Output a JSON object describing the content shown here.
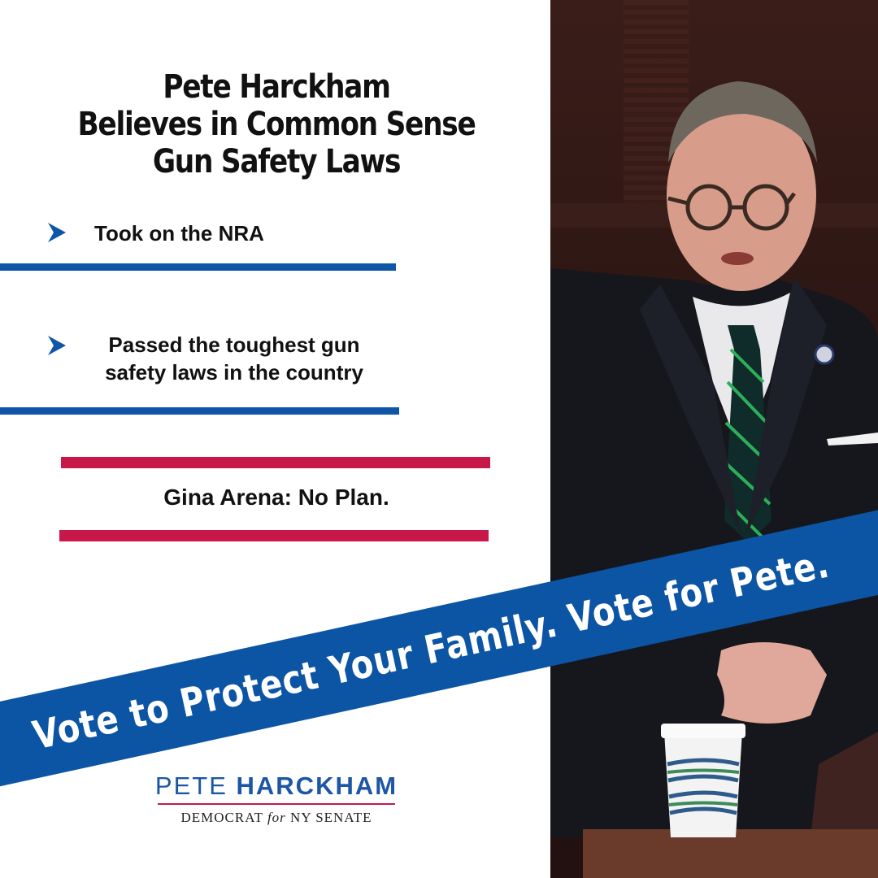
{
  "title": {
    "line1": "Pete Harckham",
    "line2": "Believes in Common Sense",
    "line3": "Gun Safety Laws"
  },
  "bullets": [
    {
      "text_line1": "Took on the NRA",
      "text_line2": "",
      "icon": "chevron-right-icon"
    },
    {
      "text_line1": "Passed the toughest gun",
      "text_line2": "safety laws in the country",
      "icon": "chevron-right-icon"
    }
  ],
  "contrast": {
    "text": "Gina Arena: No Plan."
  },
  "banner": {
    "text": "Vote to Protect Your Family. Vote for Pete."
  },
  "logo": {
    "first_name": "PETE",
    "last_name": "HARCKHAM",
    "subtitle_pre": "DEMOCRAT",
    "subtitle_for": "for",
    "subtitle_post": "NY SENATE"
  },
  "colors": {
    "blue": "#0f56a8",
    "red": "#c8184a",
    "text": "#111111"
  },
  "photo": {
    "subject": "Pete Harckham speaking in legislative chamber"
  }
}
